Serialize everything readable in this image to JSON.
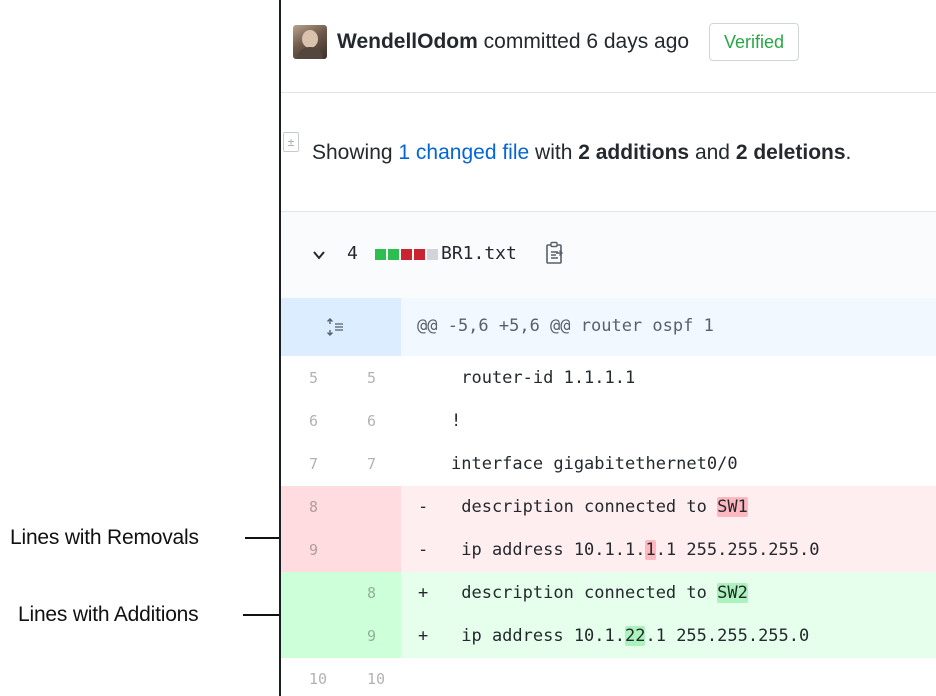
{
  "callouts": {
    "removals": "Lines with Removals",
    "additions": "Lines with Additions"
  },
  "commit": {
    "author": "WendellOdom",
    "action": "committed 6 days ago",
    "badge": "Verified"
  },
  "summary": {
    "prefix": "Showing",
    "changed_link": "1 changed file",
    "mid1": "with",
    "additions": "2 additions",
    "mid2": "and",
    "deletions": "2 deletions",
    "end": "."
  },
  "file": {
    "change_count": "4",
    "name": "BR1.txt",
    "diffstat_colors": [
      "#2cbe4e",
      "#2cbe4e",
      "#cb2431",
      "#cb2431",
      "#d1d5da"
    ]
  },
  "hunk": {
    "header": "@@ -5,6 +5,6 @@ router ospf 1"
  },
  "lines": [
    {
      "type": "context",
      "old": "5",
      "new": "5",
      "marker": "",
      "pre": " router-id 1.1.1.1",
      "hl": "",
      "post": ""
    },
    {
      "type": "context",
      "old": "6",
      "new": "6",
      "marker": "",
      "pre": "!",
      "hl": "",
      "post": ""
    },
    {
      "type": "context",
      "old": "7",
      "new": "7",
      "marker": "",
      "pre": "interface gigabitethernet0/0",
      "hl": "",
      "post": ""
    },
    {
      "type": "del",
      "old": "8",
      "new": "",
      "marker": "-",
      "pre": " description connected to ",
      "hl": "SW1",
      "post": ""
    },
    {
      "type": "del",
      "old": "9",
      "new": "",
      "marker": "-",
      "pre": " ip address 10.1.1.",
      "hl": "1",
      "post": ".1 255.255.255.0"
    },
    {
      "type": "add",
      "old": "",
      "new": "8",
      "marker": "+",
      "pre": " description connected to ",
      "hl": "SW2",
      "post": ""
    },
    {
      "type": "add",
      "old": "",
      "new": "9",
      "marker": "+",
      "pre": " ip address 10.1.",
      "hl": "22",
      "post": ".1 255.255.255.0"
    },
    {
      "type": "context",
      "old": "10",
      "new": "10",
      "marker": "",
      "pre": "",
      "hl": "",
      "post": ""
    }
  ]
}
